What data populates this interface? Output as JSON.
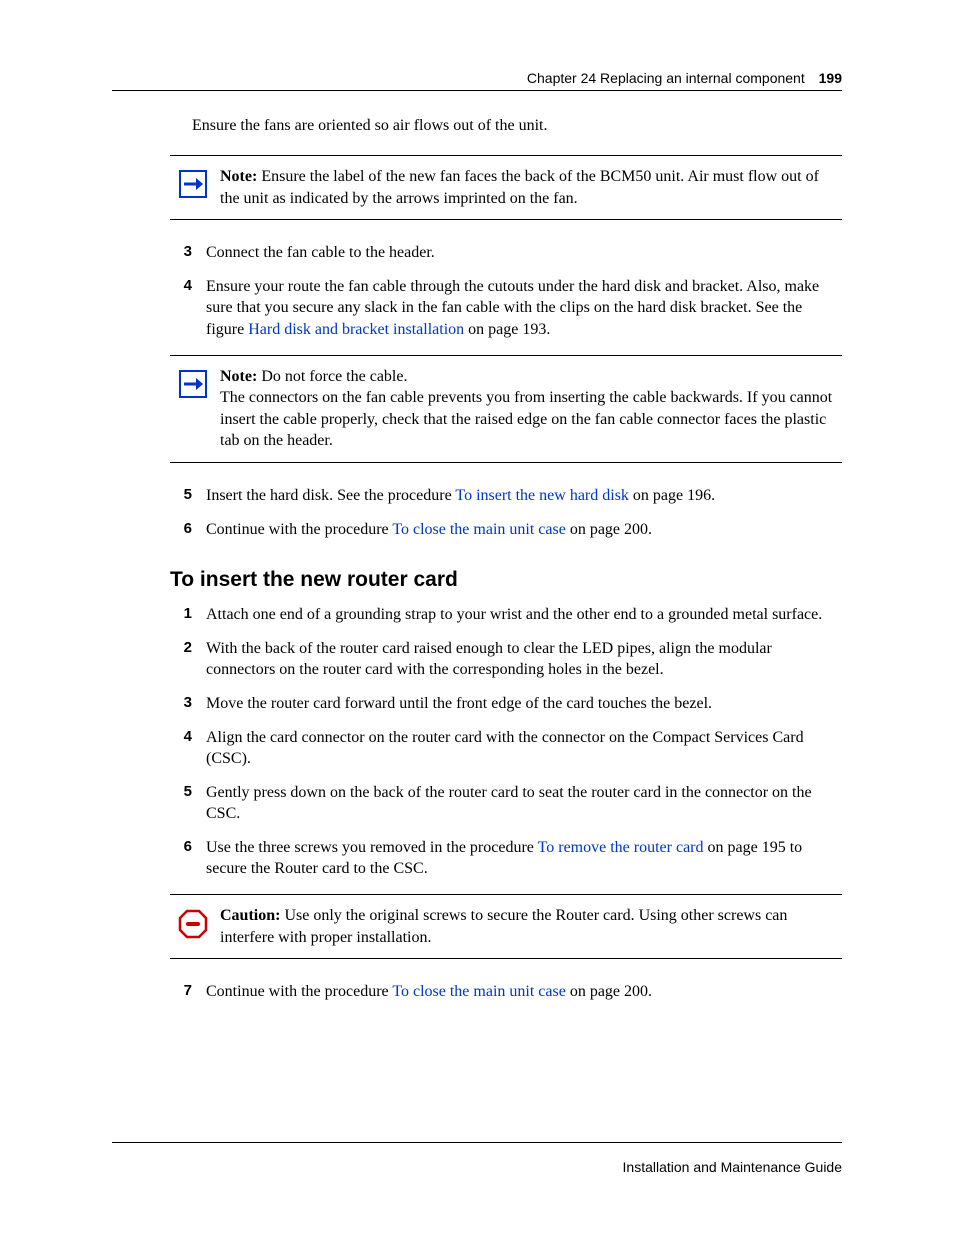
{
  "header": {
    "chapter": "Chapter 24  Replacing an internal component",
    "page": "199"
  },
  "intro": "Ensure the fans are oriented so air flows out of the unit.",
  "callout1": {
    "label": "Note:",
    "text": " Ensure the label of the new fan faces the back of the BCM50 unit. Air must flow out of the unit as indicated by the arrows imprinted on the fan."
  },
  "steps_a": [
    {
      "n": "3",
      "text": "Connect the fan cable to the header."
    },
    {
      "n": "4",
      "pre": "Ensure your route the fan cable through the cutouts under the hard disk and bracket. Also, make sure that you secure any slack in the fan cable with the clips on the hard disk bracket. See the figure ",
      "link": "Hard disk and bracket installation",
      "post": " on page 193."
    }
  ],
  "callout2": {
    "label": "Note:",
    "text1": " Do not force the cable.",
    "text2": "The connectors on the fan cable prevents you from inserting the cable backwards. If you cannot insert the cable properly, check that the raised edge on the fan cable connector faces the plastic tab on the header."
  },
  "steps_b": [
    {
      "n": "5",
      "pre": "Insert the hard disk. See the procedure ",
      "link": "To insert the new hard disk",
      "post": " on page 196."
    },
    {
      "n": "6",
      "pre": "Continue with the procedure ",
      "link": "To close the main unit case",
      "post": " on page 200."
    }
  ],
  "section_heading": "To insert the new router card",
  "steps_c": [
    {
      "n": "1",
      "text": "Attach one end of a grounding strap to your wrist and the other end to a grounded metal surface."
    },
    {
      "n": "2",
      "text": "With the back of the router card raised enough to clear the LED pipes, align the modular connectors on the router card with the corresponding holes in the bezel."
    },
    {
      "n": "3",
      "text": "Move the router card forward until the front edge of the card touches the bezel."
    },
    {
      "n": "4",
      "text": "Align the card connector on the router card with the connector on the Compact Services Card (CSC)."
    },
    {
      "n": "5",
      "text": "Gently press down on the back of the router card to seat the router card in the connector on the CSC."
    },
    {
      "n": "6",
      "pre": "Use the three screws you removed in the procedure ",
      "link": "To remove the router card",
      "post": " on page 195 to secure the Router card to the CSC."
    }
  ],
  "callout3": {
    "label": "Caution:",
    "text": " Use only the original screws to secure the Router card. Using other screws can interfere with proper installation."
  },
  "steps_d": [
    {
      "n": "7",
      "pre": "Continue with the procedure ",
      "link": "To close the main unit case",
      "post": " on page 200."
    }
  ],
  "footer": "Installation and Maintenance Guide"
}
